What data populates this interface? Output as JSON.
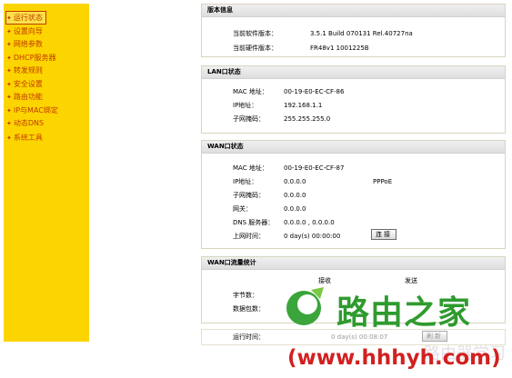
{
  "sidebar": {
    "items": [
      {
        "label": "运行状态",
        "active": true
      },
      {
        "label": "设置向导",
        "active": false
      },
      {
        "label": "网络参数",
        "active": false
      },
      {
        "label": "DHCP服务器",
        "active": false
      },
      {
        "label": "转发规则",
        "active": false
      },
      {
        "label": "安全设置",
        "active": false
      },
      {
        "label": "路由功能",
        "active": false
      },
      {
        "label": "IP与MAC绑定",
        "active": false
      },
      {
        "label": "动态DNS",
        "active": false
      },
      {
        "label": "系统工具",
        "active": false
      }
    ]
  },
  "version": {
    "title": "版本信息",
    "software_label": "当前软件版本：",
    "software_value": "3.5.1 Build 070131 Rel.40727na",
    "hardware_label": "当前硬件版本：",
    "hardware_value": "FR48v1 1001225B"
  },
  "lan": {
    "title": "LAN口状态",
    "mac_label": "MAC 地址：",
    "mac_value": "00-19-E0-EC-CF-86",
    "ip_label": "IP地址：",
    "ip_value": "192.168.1.1",
    "mask_label": "子网掩码：",
    "mask_value": "255.255.255.0"
  },
  "wan": {
    "title": "WAN口状态",
    "mac_label": "MAC 地址：",
    "mac_value": "00-19-E0-EC-CF-87",
    "ip_label": "IP地址：",
    "ip_value": "0.0.0.0",
    "ip_type": "PPPoE",
    "mask_label": "子网掩码：",
    "mask_value": "0.0.0.0",
    "gateway_label": "网关：",
    "gateway_value": "0.0.0.0",
    "dns_label": "DNS 服务器：",
    "dns_value": "0.0.0.0 , 0.0.0.0",
    "online_label": "上网时间：",
    "online_value": "0 day(s) 00:00:00",
    "connect_button": "连接"
  },
  "traffic": {
    "title": "WAN口流量统计",
    "recv_header": "接收",
    "send_header": "发送",
    "bytes_label": "字节数：",
    "packets_label": "数据包数："
  },
  "runtime": {
    "label": "运行时间：",
    "value": "0 day(s) 00:08:07",
    "button": "刷新"
  },
  "watermark": {
    "title": "路由之家",
    "url": "(www.hhhyh.com)",
    "ghost": "路由器学习"
  },
  "colors": {
    "sidebar_bg": "#fcd500",
    "menu_text": "#c23a00",
    "logo_green": "#3aa53a",
    "url_red": "#d22020"
  }
}
